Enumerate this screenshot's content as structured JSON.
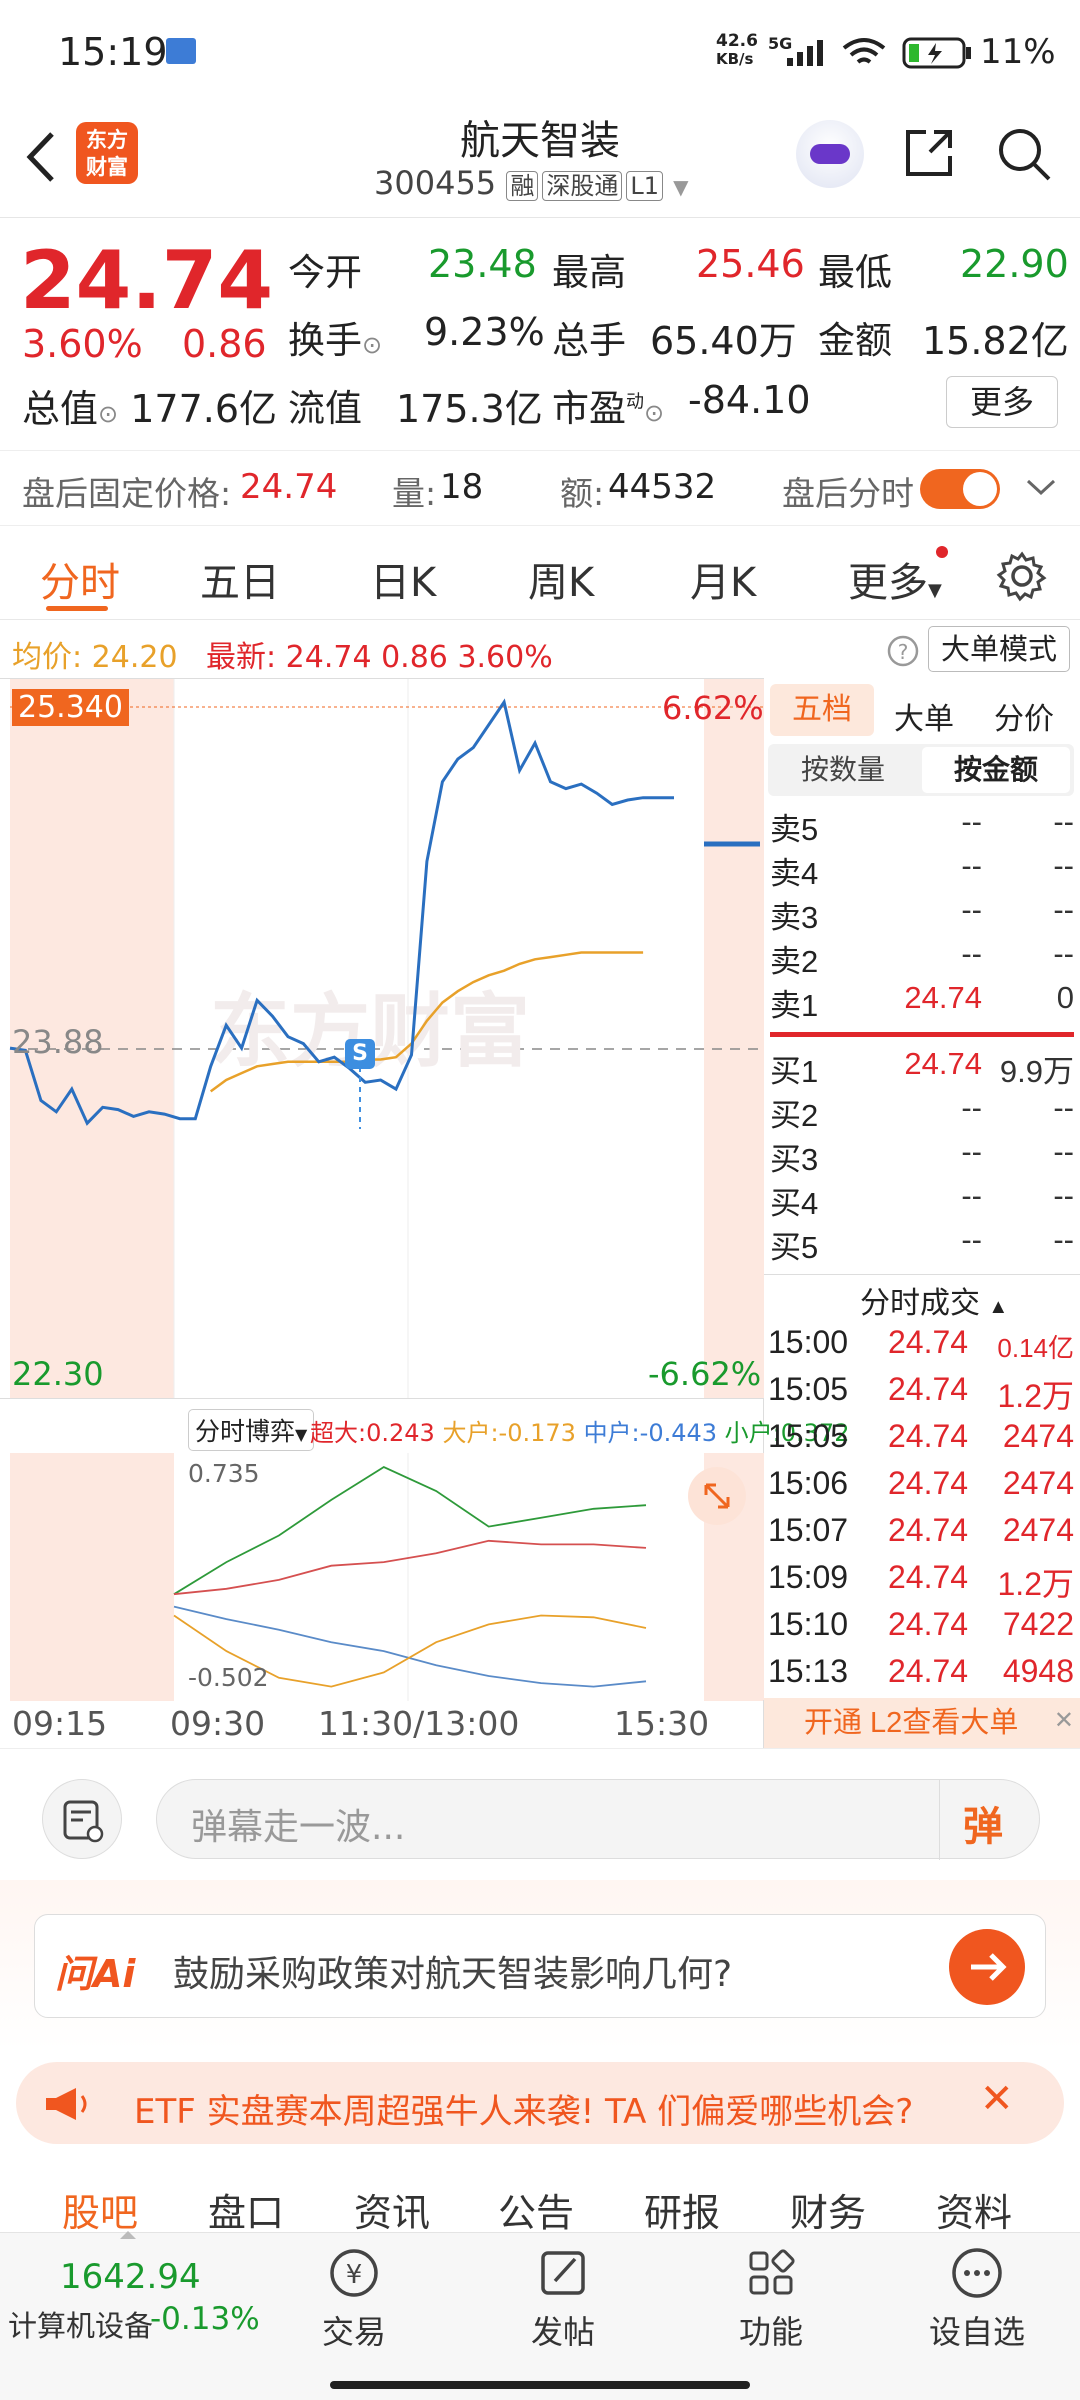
{
  "status": {
    "time": "15:19",
    "speed": "42.6",
    "speed_unit": "KB/s",
    "net": "5G",
    "battery": "11%"
  },
  "header": {
    "logo_line1": "东方",
    "logo_line2": "财富",
    "name": "航天智装",
    "code": "300455",
    "tag1": "融",
    "tag2": "深股通",
    "tag3": "L1"
  },
  "quote": {
    "price": "24.74",
    "pct": "3.60%",
    "chg": "0.86",
    "open_label": "今开",
    "open": "23.48",
    "high_label": "最高",
    "high": "25.46",
    "low_label": "最低",
    "low": "22.90",
    "turnover_label": "换手",
    "turnover": "9.23%",
    "vol_label": "总手",
    "vol": "65.40万",
    "amount_label": "金额",
    "amount": "15.82亿",
    "mcap_label": "总值",
    "mcap": "177.6亿",
    "float_label": "流值",
    "float": "175.3亿",
    "pe_label": "市盈",
    "pe_sup": "动",
    "pe": "-84.10",
    "more": "更多"
  },
  "afterhours": {
    "label": "盘后固定价格:",
    "price": "24.74",
    "vol_label": "量:",
    "vol": "18",
    "amt_label": "额:",
    "amt": "44532",
    "toggle_label": "盘后分时"
  },
  "tabs": [
    "分时",
    "五日",
    "日K",
    "周K",
    "月K",
    "更多"
  ],
  "chart_info": {
    "avg_label": "均价:",
    "avg": "24.20",
    "latest_label": "最新:",
    "latest": "24.74",
    "chg": "0.86",
    "pct": "3.60%",
    "mode_btn": "大单模式"
  },
  "chart_data": {
    "type": "line",
    "x_ticks": [
      "09:15",
      "09:30",
      "11:30/13:00",
      "15:30"
    ],
    "y_top": "25.340",
    "y_mid": "23.88",
    "y_bottom": "22.30",
    "pct_top": "6.62%",
    "pct_bottom": "-6.62%",
    "ylim": [
      22.3,
      25.34
    ],
    "prev_close": 23.88,
    "marker": "S",
    "price_series": [
      23.78,
      23.77,
      23.55,
      23.5,
      23.6,
      23.45,
      23.52,
      23.51,
      23.48,
      23.5,
      23.49,
      23.47,
      23.47,
      23.7,
      23.88,
      23.78,
      23.99,
      23.92,
      23.83,
      23.8,
      23.72,
      23.74,
      23.69,
      23.63,
      23.64,
      23.6,
      23.75,
      24.6,
      24.95,
      25.05,
      25.1,
      25.2,
      25.3,
      25.0,
      25.12,
      24.95,
      24.92,
      24.94,
      24.9,
      24.85,
      24.87,
      24.88,
      24.88,
      24.88
    ],
    "avg_series": [
      null,
      null,
      null,
      null,
      null,
      null,
      null,
      null,
      null,
      null,
      null,
      null,
      null,
      23.59,
      23.64,
      23.67,
      23.7,
      23.71,
      23.72,
      23.72,
      23.72,
      23.72,
      23.72,
      23.73,
      23.73,
      23.74,
      23.8,
      23.9,
      23.98,
      24.03,
      24.07,
      24.1,
      24.12,
      24.15,
      24.17,
      24.18,
      24.19,
      24.2,
      24.2,
      24.2,
      24.2,
      24.2,
      null,
      null
    ]
  },
  "flow": {
    "btn": "分时博弈",
    "super_label": "超大:",
    "super": "0.243",
    "big_label": "大户:",
    "big": "-0.173",
    "mid_label": "中户:",
    "mid": "-0.443",
    "small_label": "小户:",
    "small": "0.372",
    "max": "0.735",
    "min": "-0.502",
    "lines": {
      "green": [
        0.02,
        0.2,
        0.35,
        0.55,
        0.735,
        0.6,
        0.4,
        0.45,
        0.5,
        0.52
      ],
      "red": [
        0.02,
        0.05,
        0.1,
        0.18,
        0.2,
        0.25,
        0.32,
        0.3,
        0.3,
        0.28
      ],
      "blue": [
        -0.05,
        -0.12,
        -0.18,
        -0.25,
        -0.3,
        -0.38,
        -0.44,
        -0.48,
        -0.5,
        -0.47
      ],
      "orange": [
        -0.1,
        -0.3,
        -0.45,
        -0.5,
        -0.42,
        -0.25,
        -0.15,
        -0.1,
        -0.11,
        -0.17
      ]
    }
  },
  "orderbook": {
    "tabs": [
      "五档",
      "大单",
      "分价"
    ],
    "sub": [
      "按数量",
      "按金额"
    ],
    "asks": [
      {
        "label": "卖5",
        "price": "--",
        "vol": "--"
      },
      {
        "label": "卖4",
        "price": "--",
        "vol": "--"
      },
      {
        "label": "卖3",
        "price": "--",
        "vol": "--"
      },
      {
        "label": "卖2",
        "price": "--",
        "vol": "--"
      },
      {
        "label": "卖1",
        "price": "24.74",
        "vol": "0"
      }
    ],
    "bids": [
      {
        "label": "买1",
        "price": "24.74",
        "vol": "9.9万"
      },
      {
        "label": "买2",
        "price": "--",
        "vol": "--"
      },
      {
        "label": "买3",
        "price": "--",
        "vol": "--"
      },
      {
        "label": "买4",
        "price": "--",
        "vol": "--"
      },
      {
        "label": "买5",
        "price": "--",
        "vol": "--"
      }
    ],
    "trades_title": "分时成交",
    "trades": [
      {
        "t": "15:00",
        "p": "24.74",
        "v": "0.14亿"
      },
      {
        "t": "15:05",
        "p": "24.74",
        "v": "1.2万"
      },
      {
        "t": "15:05",
        "p": "24.74",
        "v": "2474"
      },
      {
        "t": "15:06",
        "p": "24.74",
        "v": "2474"
      },
      {
        "t": "15:07",
        "p": "24.74",
        "v": "2474"
      },
      {
        "t": "15:09",
        "p": "24.74",
        "v": "1.2万"
      },
      {
        "t": "15:10",
        "p": "24.74",
        "v": "7422"
      },
      {
        "t": "15:13",
        "p": "24.74",
        "v": "4948"
      }
    ],
    "l2": "开通 L2查看大单"
  },
  "danmu": {
    "placeholder": "弹幕走一波...",
    "btn": "弹"
  },
  "ai": {
    "logo": "问Ai",
    "text": "鼓励采购政策对航天智装影响几何?"
  },
  "banner": {
    "text": "ETF 实盘赛本周超强牛人来袭! TA 们偏爱哪些机会?"
  },
  "subtabs": [
    "股吧",
    "盘口",
    "资讯",
    "公告",
    "研报",
    "财务",
    "资料"
  ],
  "bottom": {
    "index_val": "1642.94",
    "index_name": "计算机设备",
    "index_pct": "-0.13%",
    "trade": "交易",
    "post": "发帖",
    "func": "功能",
    "fav": "设自选"
  },
  "colors": {
    "up": "#e0262b",
    "down": "#199a2d",
    "accent": "#f0661f",
    "price_line": "#2a6fc0",
    "avg_line": "#e8a12a"
  }
}
